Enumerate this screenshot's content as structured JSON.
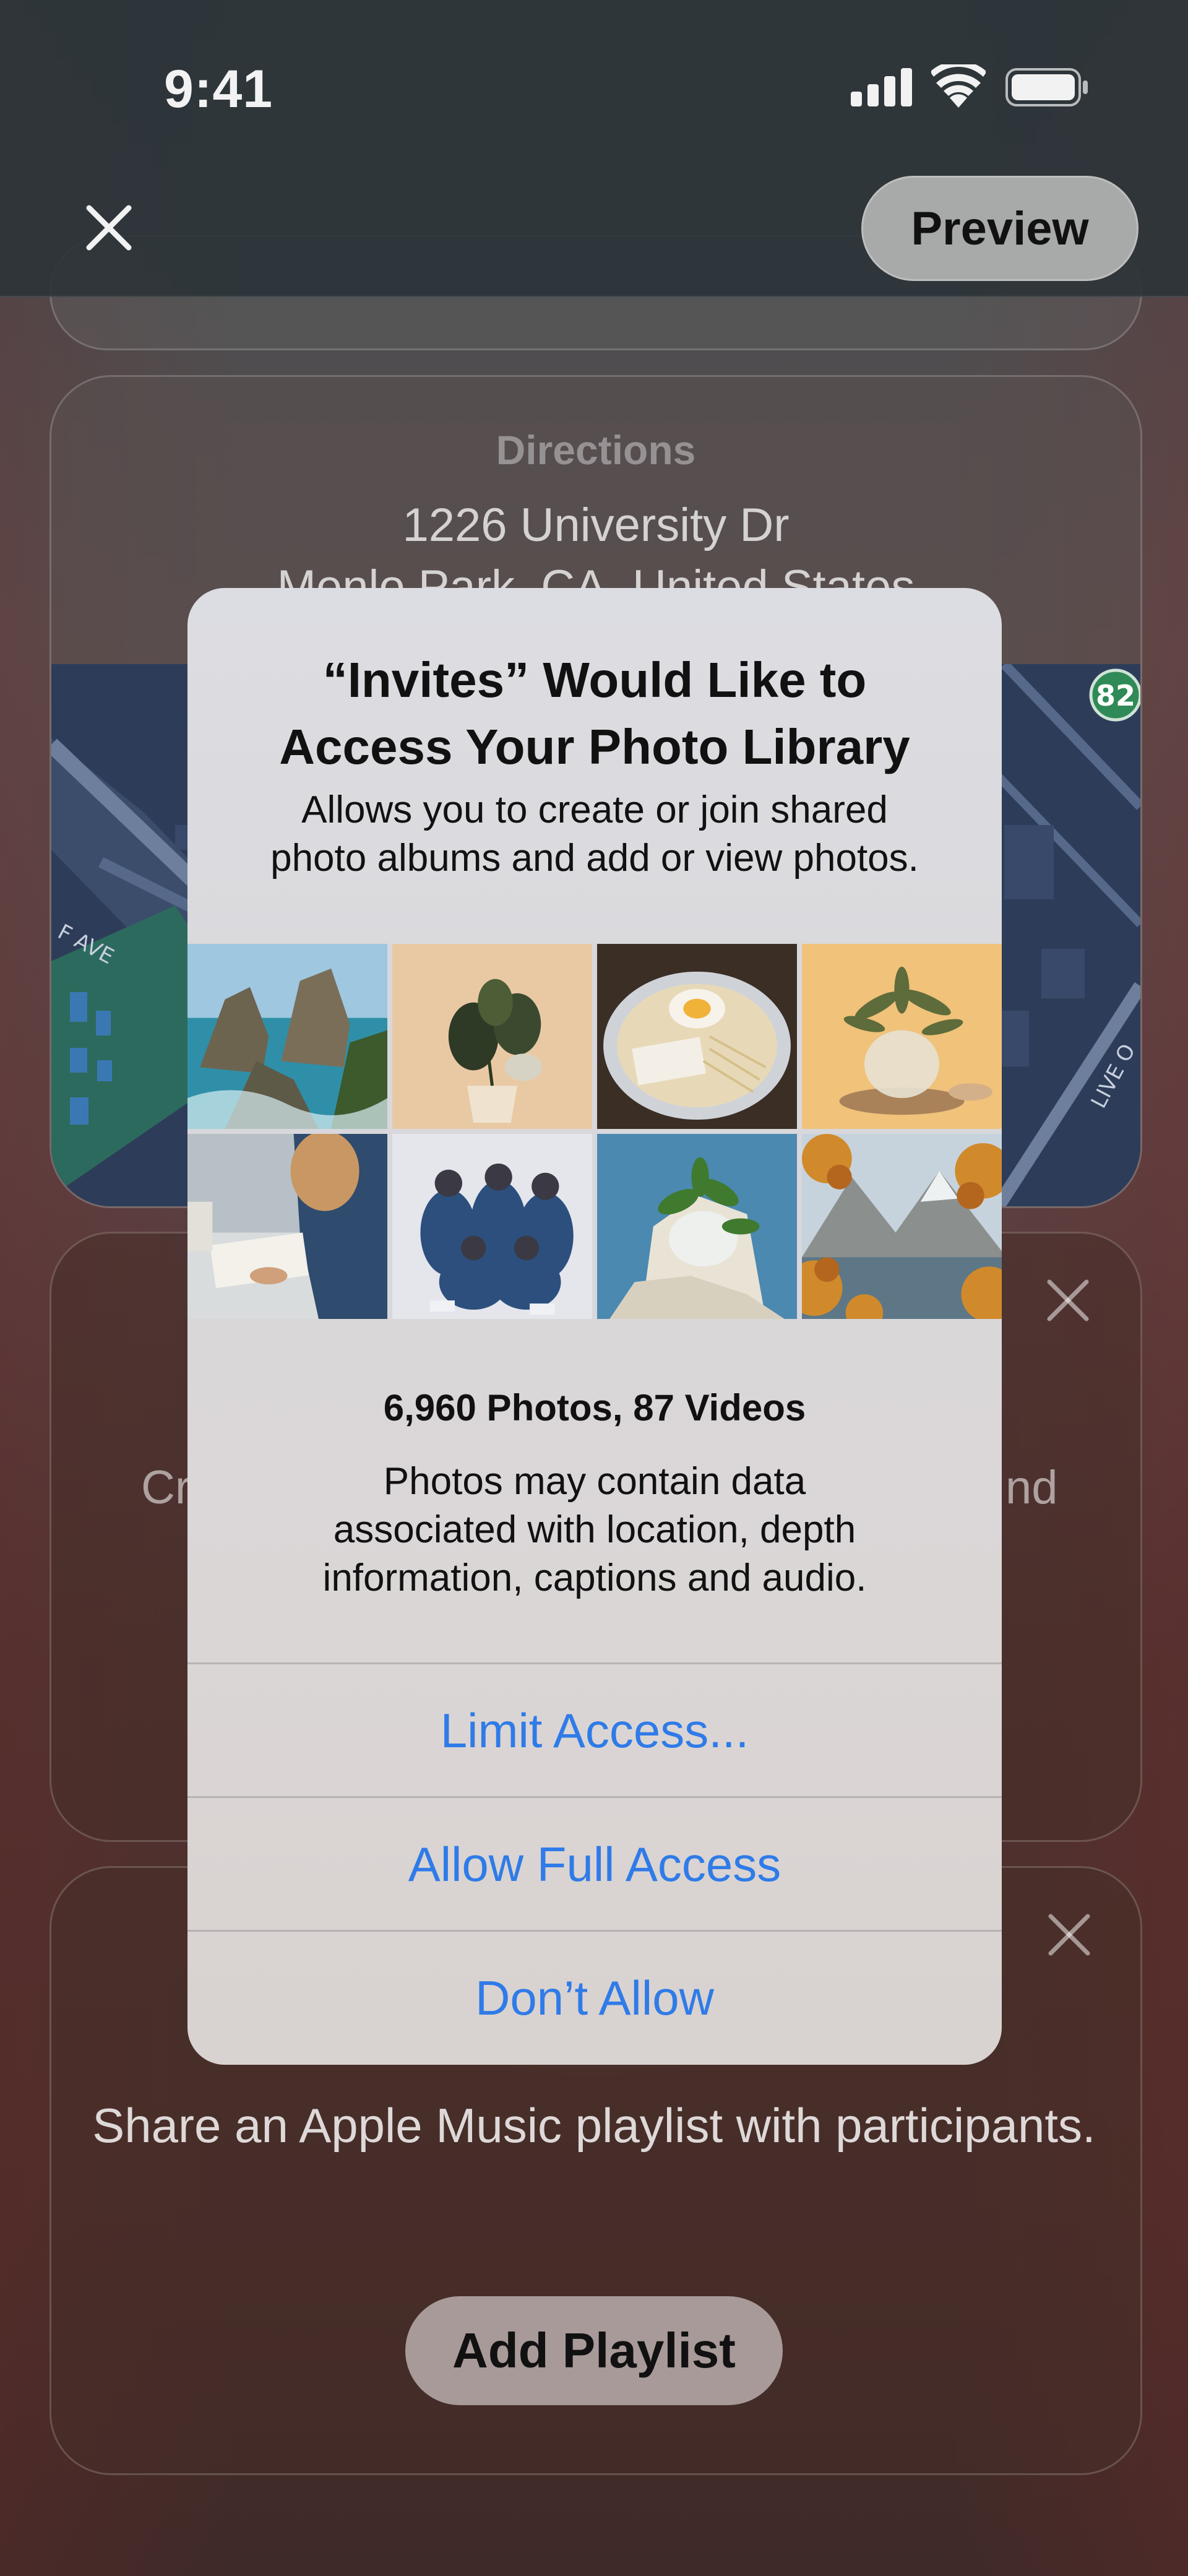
{
  "status_bar": {
    "time": "9:41"
  },
  "nav": {
    "preview_label": "Preview"
  },
  "directions_card": {
    "label": "Directions",
    "address_line1": "1226 University Dr",
    "address_line2": "Menlo Park, CA, United States",
    "map_labels": [
      "82",
      "F AVE",
      "LIVE O"
    ]
  },
  "middle_card": {
    "text_left": "Cr",
    "text_right": "nd"
  },
  "playlist_card": {
    "description": "Share an Apple Music playlist with participants.",
    "button_label": "Add Playlist"
  },
  "alert": {
    "title": "“Invites” Would Like to Access Your Photo Library",
    "message": "Allows you to create or join shared photo albums and add or view photos.",
    "photo_count": "6,960 Photos, 87 Videos",
    "photo_note": "Photos may contain data associated with location, depth information, captions and audio.",
    "buttons": {
      "limit": "Limit Access...",
      "full": "Allow Full Access",
      "deny": "Don’t Allow"
    }
  },
  "colors": {
    "alert_button_text": "#2f7be8",
    "map_background": "#2d3d59"
  }
}
